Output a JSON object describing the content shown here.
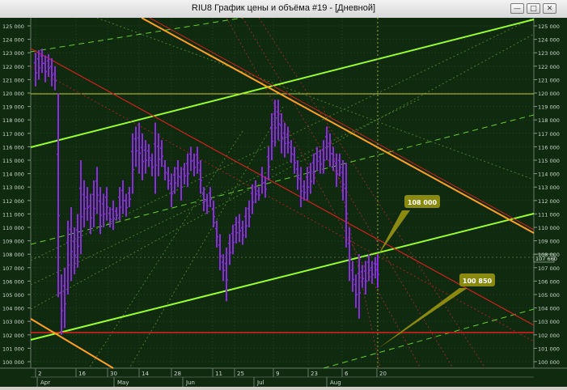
{
  "window": {
    "title": "RIU8 График цены и объёма #19 - [Дневной]",
    "minimize_icon": "minimize-icon",
    "restore_icon": "restore-icon",
    "close_icon": "close-icon"
  },
  "price_axis": {
    "labels": [
      "125 000",
      "124 000",
      "123 000",
      "122 000",
      "121 000",
      "120 000",
      "119 000",
      "118 000",
      "117 000",
      "116 000",
      "115 000",
      "114 000",
      "113 000",
      "112 000",
      "111 000",
      "110 000",
      "109 000",
      "108 000",
      "107 000",
      "106 000",
      "105 000",
      "104 000",
      "103 000",
      "102 000",
      "101 000",
      "100 000"
    ],
    "current_price": "107 660"
  },
  "date_axis": {
    "day_labels": [
      "2",
      "16",
      "30",
      "14",
      "28",
      "11",
      "25",
      "9",
      "23",
      "6",
      "20"
    ],
    "month_labels": [
      "Apr",
      "May",
      "Jun",
      "Jul",
      "Aug"
    ]
  },
  "callouts": [
    {
      "label": "108 000"
    },
    {
      "label": "100 850"
    }
  ],
  "colors": {
    "background": "#0f2a0f",
    "bars": "#8a2be2",
    "channel_green": "#9aff2a",
    "channel_orange": "#ffa020",
    "support_red": "#cc2020",
    "callout": "#8a8a10"
  }
}
